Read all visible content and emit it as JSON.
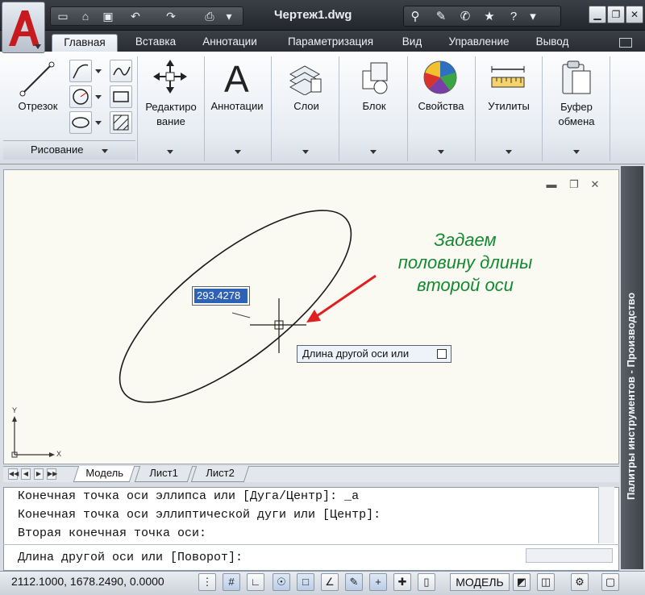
{
  "titlebar": {
    "document_title": "Чертеж1.dwg"
  },
  "tabs": [
    {
      "label": "Главная",
      "active": true
    },
    {
      "label": "Вставка",
      "active": false
    },
    {
      "label": "Аннотации",
      "active": false
    },
    {
      "label": "Параметризация",
      "active": false
    },
    {
      "label": "Вид",
      "active": false
    },
    {
      "label": "Управление",
      "active": false
    },
    {
      "label": "Вывод",
      "active": false
    }
  ],
  "ribbon": {
    "line_tool": "Отрезок",
    "draw_panel_title": "Рисование",
    "modify_tool": "Редактиро вание",
    "annotation_tool": "Аннотации",
    "layers_tool": "Слои",
    "block_tool": "Блок",
    "properties_tool": "Свойства",
    "utilities_tool": "Утилиты",
    "clipboard_tool": "Буфер обмена"
  },
  "canvas": {
    "dynamic_input_value": "293.4278",
    "tooltip_text": "Длина другой оси или",
    "annotation_lines": [
      "Задаем",
      "половину длины",
      "второй оси"
    ],
    "ucs_x": "X",
    "ucs_y": "Y",
    "accent_color": "#e02020",
    "annotation_color": "#138a32"
  },
  "layout_tabs": [
    "Модель",
    "Лист1",
    "Лист2"
  ],
  "side_palette_title": "Палитры инструментов - Производство",
  "command_history": [
    "Конечная точка оси эллипса или [Дуга/Центр]: _a",
    "Конечная точка оси эллиптической дуги или [Центр]:",
    "Вторая конечная точка оси:"
  ],
  "command_prompt": "Длина другой оси или [Поворот]:",
  "status": {
    "coordinates": "2112.1000, 1678.2490, 0.0000",
    "model_label": "МОДЕЛЬ"
  }
}
